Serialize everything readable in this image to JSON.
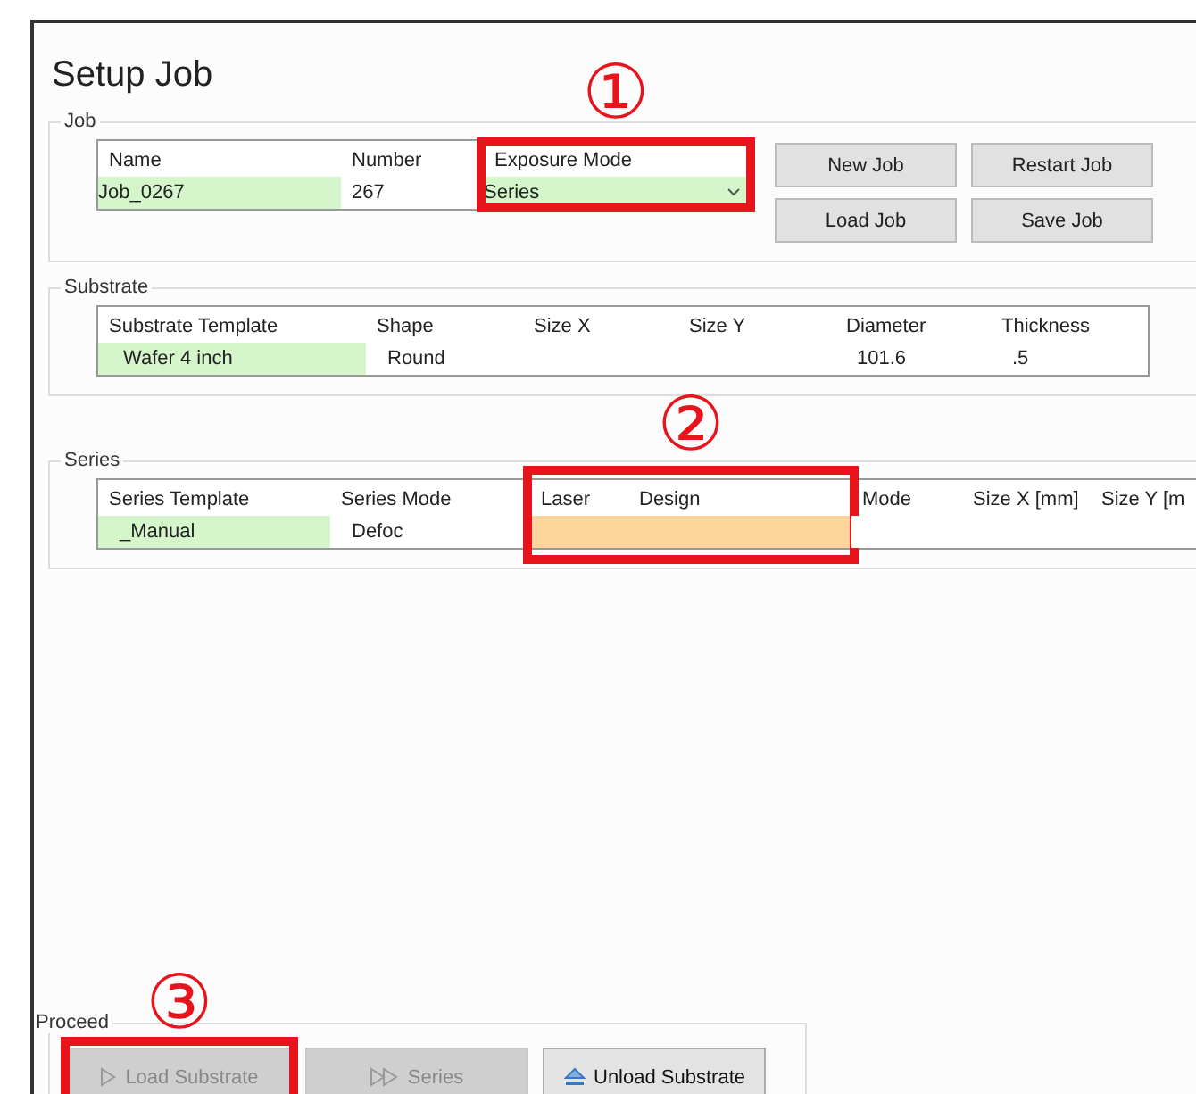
{
  "window": {
    "title": "Setup Job"
  },
  "job": {
    "label": "Job",
    "marker": "①",
    "columns": [
      {
        "header": "Name",
        "value": "Job_0267",
        "color": "#d5f5cb",
        "kind": "text"
      },
      {
        "header": "Number",
        "value": "267",
        "kind": "text"
      },
      {
        "header": "Exposure Mode",
        "value": "Series",
        "color": "#d5f5cb",
        "kind": "dropdown",
        "marked": true
      }
    ],
    "buttons": [
      "New Job",
      "Restart Job",
      "Load Job",
      "Save Job"
    ]
  },
  "substrate": {
    "label": "Substrate",
    "columns": [
      {
        "header": "Substrate Template",
        "value": "Wafer 4 inch",
        "color": "#d5f5cb"
      },
      {
        "header": "Shape",
        "value": "Round"
      },
      {
        "header": "Size X"
      },
      {
        "header": "Size Y"
      },
      {
        "header": "Diameter",
        "value": "101.6"
      },
      {
        "header": "Thickness",
        "value": ".5"
      }
    ]
  },
  "series": {
    "label": "Series",
    "marker": "②",
    "columns": [
      {
        "header": "Series Template",
        "value": "_Manual",
        "color": "#d5f5cb"
      },
      {
        "header": "Series Mode",
        "value": "Defoc"
      },
      {
        "header": "Laser",
        "color": "#fcd49c",
        "marked": true
      },
      {
        "header": "Design",
        "color": "#fcd49c",
        "marked": true
      },
      {
        "header": "Mode"
      },
      {
        "header": "Size X [mm]"
      },
      {
        "header": "Size Y [m"
      }
    ]
  },
  "proceed": {
    "label": "Proceed",
    "marker": "③",
    "buttons": [
      {
        "label": "Load Substrate",
        "kind": "play",
        "disabled": true,
        "marked": true
      },
      {
        "label": "Series",
        "kind": "double-play",
        "disabled": true
      },
      {
        "label": "Unload Substrate",
        "kind": "eject",
        "disabled": false
      }
    ]
  }
}
